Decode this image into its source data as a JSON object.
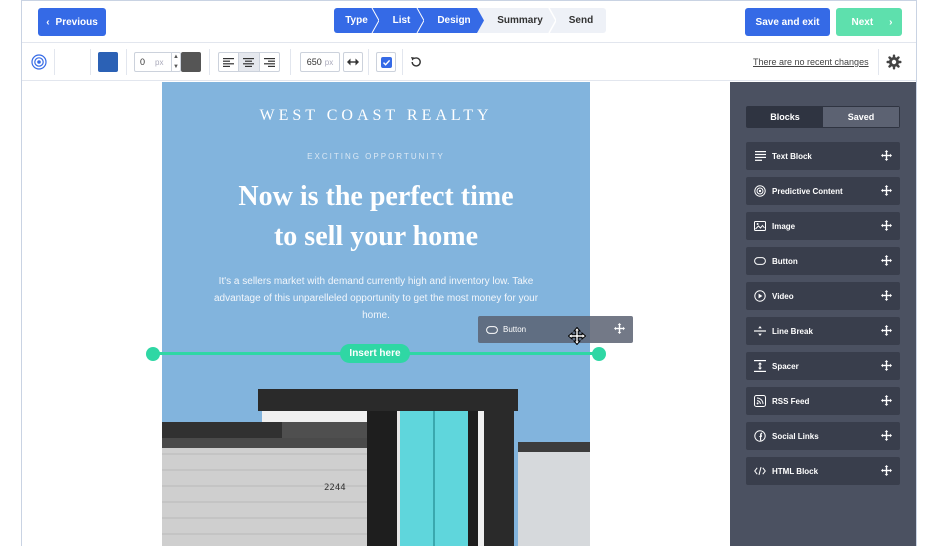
{
  "topbar": {
    "previous_label": "Previous",
    "previous_chevron": "‹",
    "save_exit_label": "Save and exit",
    "next_label": "Next",
    "next_chevron": "›",
    "steps": [
      {
        "label": "Type",
        "state": "active"
      },
      {
        "label": "List",
        "state": "active"
      },
      {
        "label": "Design",
        "state": "active"
      },
      {
        "label": "Summary",
        "state": "inactive"
      },
      {
        "label": "Send",
        "state": "inactive"
      }
    ]
  },
  "toolbar": {
    "border_value": "0",
    "border_unit": "px",
    "width_value": "650",
    "width_unit": "px",
    "recent_changes": "There are no recent changes",
    "colors": {
      "fill": "#2b61b5",
      "border": "#555555"
    },
    "text_align_selected": "center"
  },
  "email": {
    "brand": "WEST COAST REALTY",
    "eyebrow": "EXCITING OPPORTUNITY",
    "headline_line1": "Now is the perfect time",
    "headline_line2": "to sell your home",
    "body": "It's a sellers market with demand currently high and inventory low. Take advantage of this unparelleled opportunity to get the most money for your home.",
    "house_number": "2244",
    "background": "#82b4dd"
  },
  "dragging": {
    "insert_label": "Insert here",
    "ghost_label": "Button",
    "accent": "#2fd7a4"
  },
  "sidebar": {
    "tabs": [
      {
        "label": "Blocks",
        "state": "active"
      },
      {
        "label": "Saved",
        "state": "inactive"
      }
    ],
    "blocks": [
      {
        "label": "Text Block",
        "icon": "text-lines-icon"
      },
      {
        "label": "Predictive Content",
        "icon": "target-icon"
      },
      {
        "label": "Image",
        "icon": "image-icon"
      },
      {
        "label": "Button",
        "icon": "button-pill-icon"
      },
      {
        "label": "Video",
        "icon": "play-icon"
      },
      {
        "label": "Line Break",
        "icon": "line-break-icon"
      },
      {
        "label": "Spacer",
        "icon": "spacer-icon"
      },
      {
        "label": "RSS Feed",
        "icon": "rss-icon"
      },
      {
        "label": "Social Links",
        "icon": "facebook-icon"
      },
      {
        "label": "HTML Block",
        "icon": "code-icon"
      }
    ]
  }
}
